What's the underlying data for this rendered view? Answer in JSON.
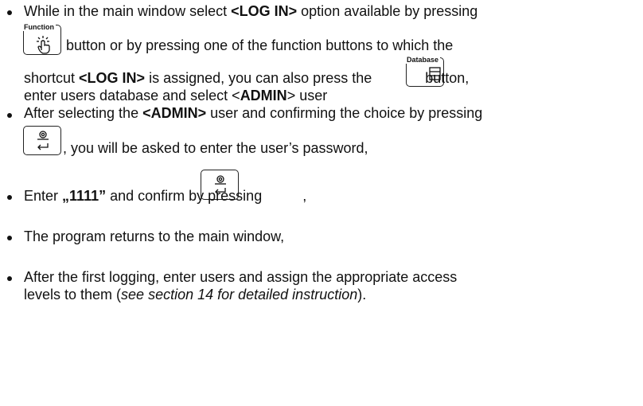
{
  "bullets": [
    {
      "line1": {
        "pre": "While in the main window select ",
        "bold": "<LOG IN>",
        "post": " option available by pressing"
      },
      "line2": "button or by pressing one of the function buttons to which the",
      "line3": {
        "pre": "shortcut ",
        "bold": "<LOG IN>",
        "post": " is assigned, you can also press the ",
        "post2": " button,"
      },
      "line4": {
        "pre": "enter users database and select <",
        "bold": "ADMIN",
        "post": "> user"
      }
    },
    {
      "line1": {
        "pre": "After selecting the ",
        "bold": "<ADMIN>",
        "post": " user and confirming the choice by pressing"
      },
      "line2": ", you will be asked to enter the user’s password,"
    },
    {
      "line1": {
        "pre": "Enter ",
        "bold": "„1111”",
        "post": " and confirm by pressing ",
        "post2": ","
      }
    },
    {
      "line1": "The program returns to the main window,"
    },
    {
      "line1": "After the first logging, enter users and assign the appropriate access",
      "line2": {
        "pre": "levels to them (",
        "italic": "see section 14 for detailed instruction",
        "post": ")."
      }
    }
  ],
  "keys": {
    "function": {
      "label": "Function",
      "icon": "hand-press-icon"
    },
    "database": {
      "label": "Database",
      "icon": "database-list-icon"
    },
    "enter": {
      "icon": "enter-key-icon"
    }
  }
}
